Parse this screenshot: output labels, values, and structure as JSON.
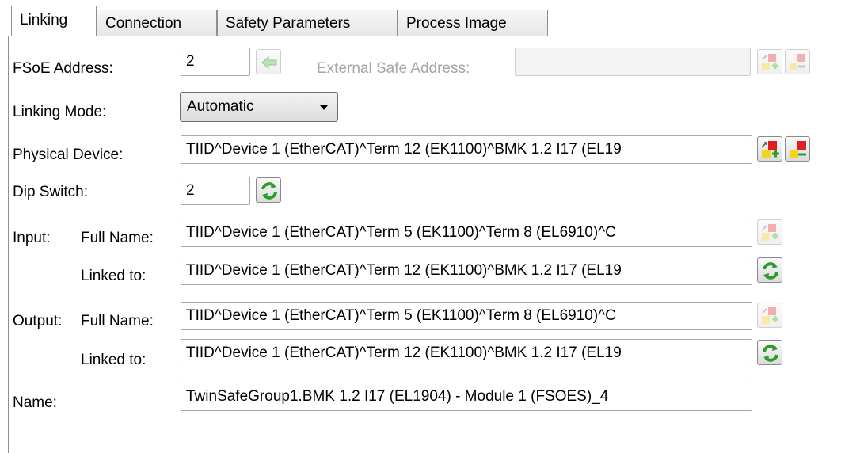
{
  "tabs": [
    {
      "label": "Linking",
      "active": true
    },
    {
      "label": "Connection",
      "active": false
    },
    {
      "label": "Safety Parameters",
      "active": false
    },
    {
      "label": "Process Image",
      "active": false
    }
  ],
  "fsoe": {
    "label": "FSoE Address:",
    "value": "2",
    "ext_label": "External Safe Address:",
    "ext_value": ""
  },
  "linking_mode": {
    "label": "Linking Mode:",
    "value": "Automatic"
  },
  "physical_device": {
    "label": "Physical Device:",
    "value": "TIID^Device 1 (EtherCAT)^Term 12 (EK1100)^BMK 1.2 I17 (EL19"
  },
  "dip_switch": {
    "label": "Dip Switch:",
    "value": "2"
  },
  "input": {
    "label": "Input:",
    "full_name_label": "Full Name:",
    "full_name": "TIID^Device 1 (EtherCAT)^Term 5 (EK1100)^Term 8 (EL6910)^C",
    "linked_label": "Linked to:",
    "linked": "TIID^Device 1 (EtherCAT)^Term 12 (EK1100)^BMK 1.2 I17 (EL19"
  },
  "output": {
    "label": "Output:",
    "full_name_label": "Full Name:",
    "full_name": "TIID^Device 1 (EtherCAT)^Term 5 (EK1100)^Term 8 (EL6910)^C",
    "linked_label": "Linked to:",
    "linked": "TIID^Device 1 (EtherCAT)^Term 12 (EK1100)^BMK 1.2 I17 (EL19"
  },
  "name": {
    "label": "Name:",
    "value": "TwinSafeGroup1.BMK 1.2 I17 (EL1904) - Module 1 (FSOES)_4"
  },
  "icons": {
    "arrow_left": "arrow-left-icon",
    "link_add": "link-add-icon",
    "link_remove": "link-remove-icon",
    "refresh": "refresh-icon"
  },
  "colors": {
    "refresh_green": "#2e9b2e",
    "add_red": "#e02020",
    "add_yellow": "#f5d21e",
    "disabled_text": "#a6a6a6"
  }
}
